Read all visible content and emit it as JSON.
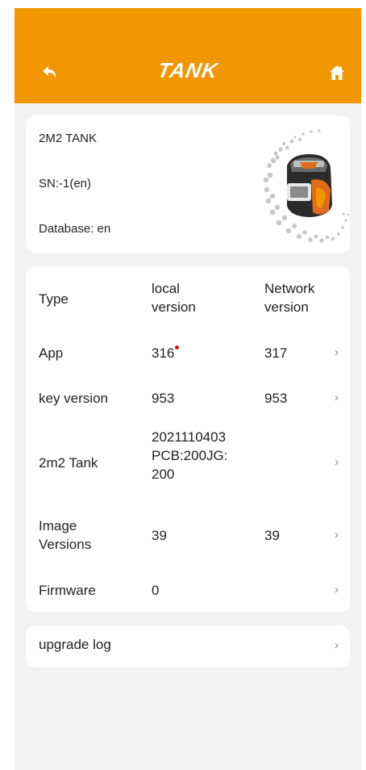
{
  "header": {
    "title": "TANK",
    "back_icon": "back-arrow-icon",
    "home_icon": "home-icon",
    "bar_color": "#f29600"
  },
  "device": {
    "name": "2M2 TANK",
    "sn": "SN:-1(en)",
    "database": "Database: en",
    "image_icon": "tank-device-icon"
  },
  "versions": {
    "headers": {
      "type": "Type",
      "local": "local\nversion",
      "network": "Network\nversion"
    },
    "rows": [
      {
        "type": "App",
        "local": "316",
        "network": "317",
        "has_update_dot": true
      },
      {
        "type": "key version",
        "local": "953",
        "network": "953"
      },
      {
        "type": "2m2 Tank",
        "local": "2021110403\nPCB:200JG:\n200",
        "network": ""
      },
      {
        "type": "Image\nVersions",
        "local": "39",
        "network": "39"
      },
      {
        "type": "Firmware",
        "local": "0",
        "network": ""
      }
    ],
    "chevron": "›"
  },
  "upgrade_log": {
    "label": "upgrade log",
    "chevron": "›"
  }
}
